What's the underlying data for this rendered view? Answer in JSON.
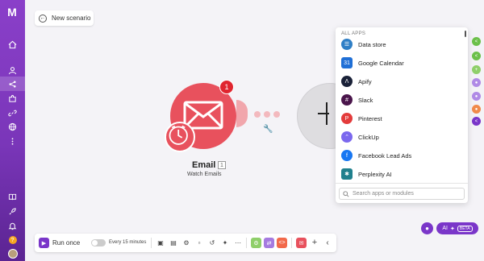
{
  "sidebar": {
    "logo": "M",
    "items": [
      "home-icon",
      "users-icon",
      "share-icon",
      "puzzle-icon",
      "link-icon",
      "globe-icon",
      "more-icon"
    ],
    "bottom": [
      "book-icon",
      "rocket-icon",
      "bell-icon",
      "help-icon",
      "avatar"
    ],
    "help_label": "?"
  },
  "header": {
    "back_label": "New scenario"
  },
  "module": {
    "name": "Email",
    "count": "1",
    "subtitle": "Watch Emails",
    "badge": "1",
    "color": "#e8515d"
  },
  "picker": {
    "heading": "ALL APPS",
    "apps": [
      {
        "label": "Data store",
        "icon": "database-icon",
        "color": "#2f7fc6"
      },
      {
        "label": "Google Calendar",
        "icon": "calendar-icon",
        "color": "#1f6fd6"
      },
      {
        "label": "Apify",
        "icon": "apify-icon",
        "color": "#1a2138"
      },
      {
        "label": "Slack",
        "icon": "slack-icon",
        "color": "#4a154b"
      },
      {
        "label": "Pinterest",
        "icon": "pinterest-icon",
        "color": "#e33b3b"
      },
      {
        "label": "ClickUp",
        "icon": "clickup-icon",
        "color": "#7b68ee"
      },
      {
        "label": "Facebook Lead Ads",
        "icon": "facebook-icon",
        "color": "#1877f2"
      },
      {
        "label": "Perplexity AI",
        "icon": "perplexity-icon",
        "color": "#20808d"
      }
    ],
    "search_placeholder": "Search apps or modules"
  },
  "toolbar": {
    "run_label": "Run once",
    "schedule_label": "Every 15 minutes"
  },
  "ai": {
    "label": "AI",
    "beta": "BETA"
  }
}
